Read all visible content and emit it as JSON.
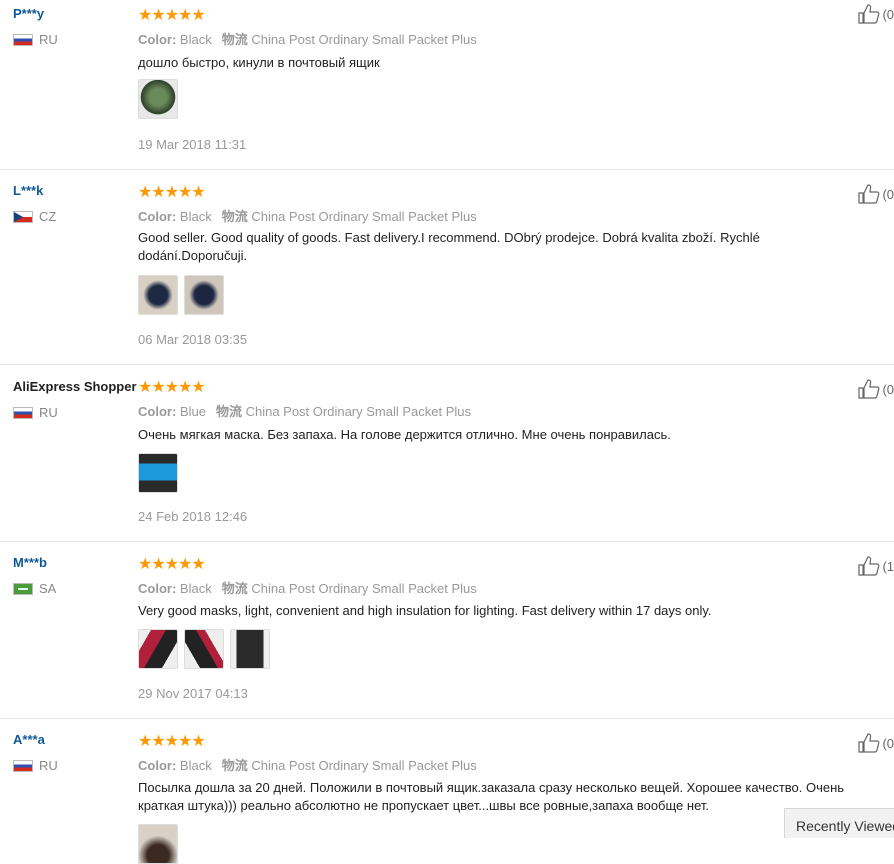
{
  "reviews": [
    {
      "user": "P***y",
      "country": "RU",
      "flag": "ru",
      "stars": "★★★★★",
      "color_label": "Color:",
      "color_value": "Black",
      "shipping_label": "物流",
      "shipping_value": "China Post Ordinary Small Packet Plus",
      "text": "дошло быстро, кинули в почтовый ящик",
      "date": "19 Mar 2018 11:31",
      "helpful": "(0"
    },
    {
      "user": "L***k",
      "country": "CZ",
      "flag": "cz",
      "stars": "★★★★★",
      "color_label": "Color:",
      "color_value": "Black",
      "shipping_label": "物流",
      "shipping_value": "China Post Ordinary Small Packet Plus",
      "text": "Good seller. Good quality of goods. Fast delivery.I recommend. DObrý prodejce. Dobrá kvalita zboží. Rychlé dodání.Doporučuji.",
      "date": "06 Mar 2018 03:35",
      "helpful": "(0"
    },
    {
      "user": "AliExpress Shopper",
      "country": "RU",
      "flag": "ru",
      "stars": "★★★★★",
      "color_label": "Color:",
      "color_value": "Blue",
      "shipping_label": "物流",
      "shipping_value": "China Post Ordinary Small Packet Plus",
      "text": "Очень мягкая маска. Без запаха. На голове держится отлично. Мне очень понравилась.",
      "date": "24 Feb 2018 12:46",
      "helpful": "(0"
    },
    {
      "user": "M***b",
      "country": "SA",
      "flag": "sa",
      "stars": "★★★★★",
      "color_label": "Color:",
      "color_value": "Black",
      "shipping_label": "物流",
      "shipping_value": "China Post Ordinary Small Packet Plus",
      "text": "Very good masks, light, convenient and high insulation for lighting. Fast delivery within 17 days only.",
      "date": "29 Nov 2017 04:13",
      "helpful": "(1"
    },
    {
      "user": "A***a",
      "country": "RU",
      "flag": "ru",
      "stars": "★★★★★",
      "color_label": "Color:",
      "color_value": "Black",
      "shipping_label": "物流",
      "shipping_value": "China Post Ordinary Small Packet Plus",
      "text": "Посылка дошла за 20 дней. Положили в почтовый ящик.заказала сразу несколько вещей. Хорошее качество. Очень краткая штука))) реально абсолютно не пропускает цвет...швы все ровные,запаха вообще нет.",
      "date": "",
      "helpful": "(0"
    }
  ],
  "recently_viewed": "Recently Viewed",
  "colors": {
    "link": "#0f5a96",
    "star": "#ff9900",
    "meta": "#999999"
  }
}
